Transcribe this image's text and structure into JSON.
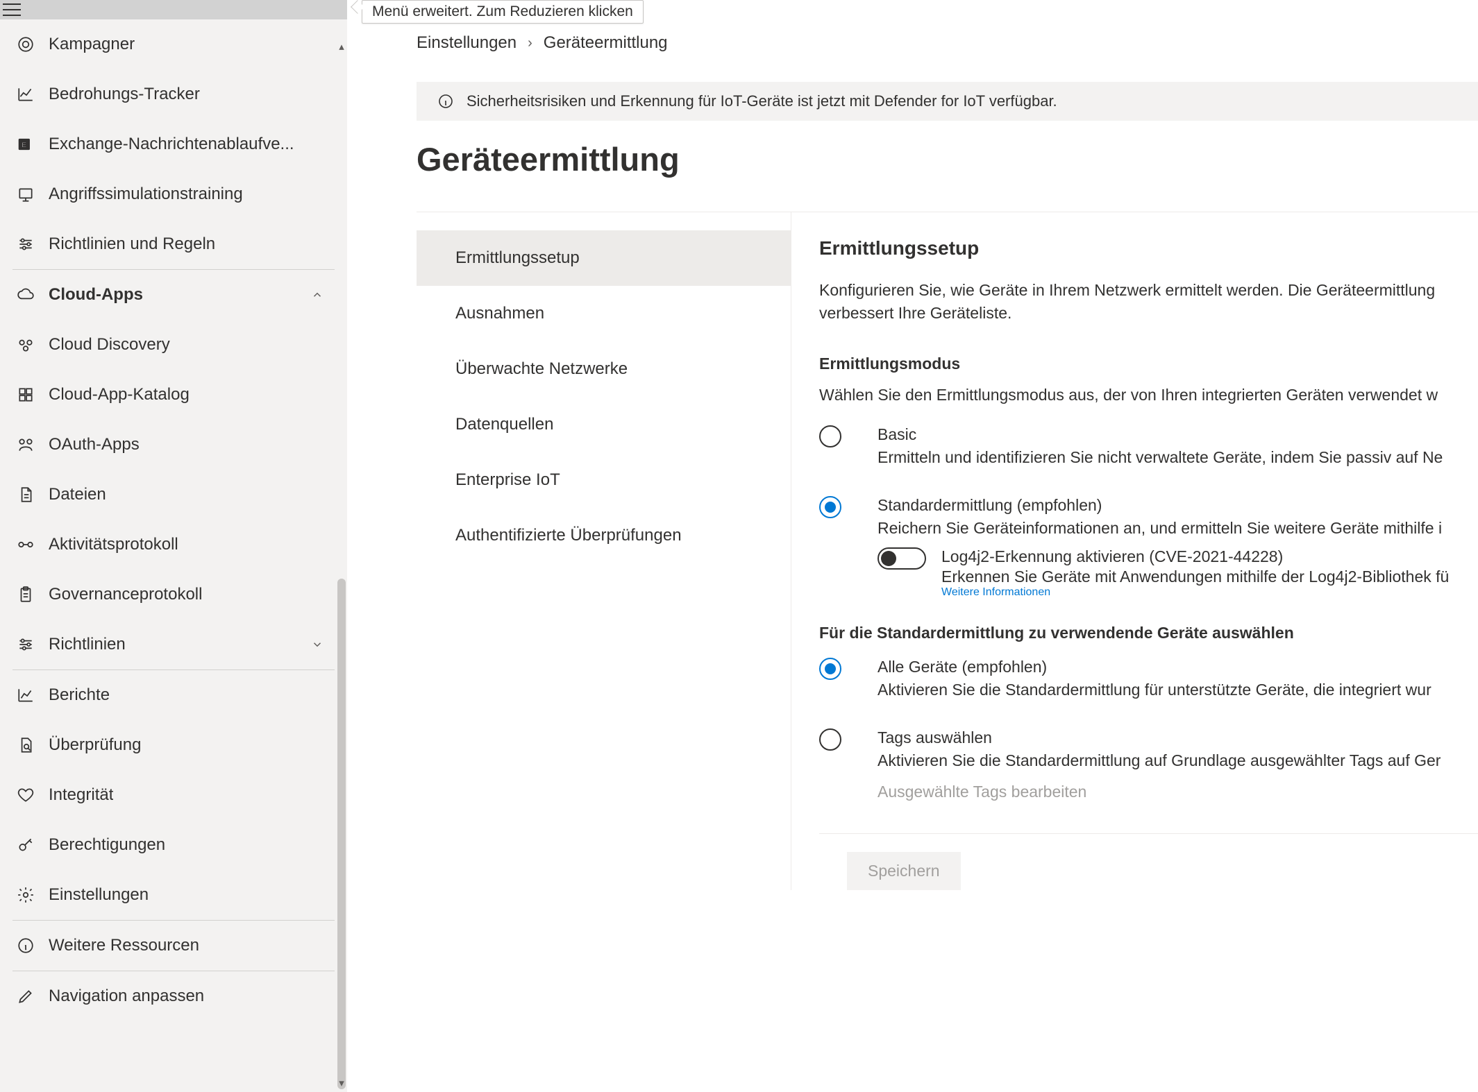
{
  "tooltip": "Menü erweitert. Zum Reduzieren klicken",
  "sidebar": {
    "items": [
      {
        "label": "Kampagner"
      },
      {
        "label": "Bedrohungs-Tracker"
      },
      {
        "label": "Exchange-Nachrichtenablaufve..."
      },
      {
        "label": "Angriffssimulationstraining"
      },
      {
        "label": "Richtlinien und Regeln"
      },
      {
        "label": "Cloud-Apps"
      },
      {
        "label": "Cloud Discovery"
      },
      {
        "label": "Cloud-App-Katalog"
      },
      {
        "label": "OAuth-Apps"
      },
      {
        "label": "Dateien"
      },
      {
        "label": "Aktivitätsprotokoll"
      },
      {
        "label": "Governanceprotokoll"
      },
      {
        "label": "Richtlinien"
      },
      {
        "label": "Berichte"
      },
      {
        "label": "Überprüfung"
      },
      {
        "label": "Integrität"
      },
      {
        "label": "Berechtigungen"
      },
      {
        "label": "Einstellungen"
      },
      {
        "label": "Weitere Ressourcen"
      },
      {
        "label": "Navigation anpassen"
      }
    ]
  },
  "breadcrumb": {
    "l1": "Einstellungen",
    "l2": "Geräteermittlung"
  },
  "banner": "Sicherheitsrisiken und Erkennung für IoT-Geräte ist jetzt mit Defender for IoT verfügbar.",
  "page_title": "Geräteermittlung",
  "tabs": [
    "Ermittlungssetup",
    "Ausnahmen",
    "Überwachte Netzwerke",
    "Datenquellen",
    "Enterprise IoT",
    "Authentifizierte Überprüfungen"
  ],
  "panel": {
    "heading": "Ermittlungssetup",
    "desc": "Konfigurieren Sie, wie Geräte in Ihrem Netzwerk ermittelt werden. Die Geräteermittlung verbessert Ihre Geräteliste.",
    "mode_heading": "Ermittlungsmodus",
    "mode_desc": "Wählen Sie den Ermittlungsmodus aus, der von Ihren integrierten Geräten verwendet w",
    "basic": {
      "title": "Basic",
      "desc": "Ermitteln und identifizieren Sie nicht verwaltete Geräte, indem Sie passiv auf Ne"
    },
    "standard": {
      "title": "Standardermittlung (empfohlen)",
      "desc": "Reichern Sie Geräteinformationen an, und ermitteln Sie weitere Geräte mithilfe i"
    },
    "log4j": {
      "title": "Log4j2-Erkennung aktivieren (CVE-2021-44228)",
      "desc": "Erkennen Sie Geräte mit Anwendungen mithilfe der Log4j2-Bibliothek fü",
      "link": "Weitere Informationen"
    },
    "devices_heading": "Für die Standardermittlung zu verwendende Geräte auswählen",
    "all": {
      "title": "Alle Geräte (empfohlen)",
      "desc": "Aktivieren Sie die Standardermittlung für unterstützte Geräte, die integriert wur"
    },
    "tags": {
      "title": "Tags auswählen",
      "desc": "Aktivieren Sie die Standardermittlung auf Grundlage ausgewählter Tags auf Ger"
    },
    "edit_tags": "Ausgewählte Tags bearbeiten",
    "save": "Speichern"
  }
}
